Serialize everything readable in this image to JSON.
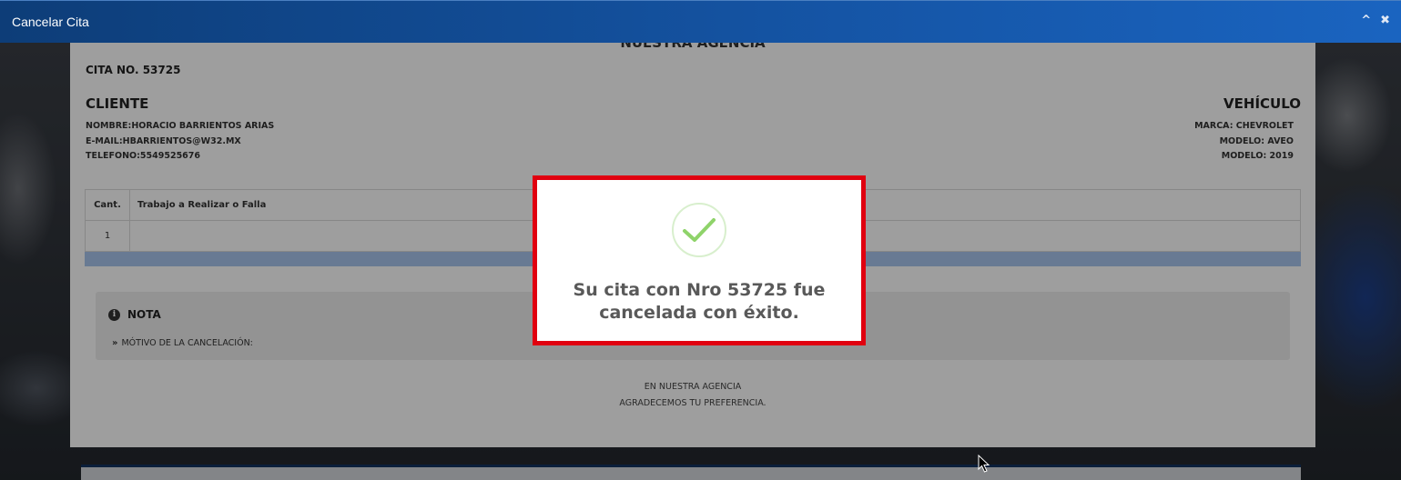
{
  "window": {
    "title": "Cancelar Cita",
    "controls": {
      "collapse": "^",
      "close": "✖"
    }
  },
  "appointment": {
    "heading": "NUESTRA AGENCIA",
    "cita_no": "CITA NO. 53725",
    "cliente": {
      "title": "CLIENTE",
      "nombre": "NOMBRE:HORACIO BARRIENTOS ARIAS",
      "email": "E-MAIL:HBARRIENTOS@W32.MX",
      "telefono": "TELEFONO:5549525676"
    },
    "vehiculo": {
      "title": "VEHÍCULO",
      "marca": "MARCA: CHEVROLET",
      "modelo": "MODELO: AVEO",
      "anio": "MODELO: 2019"
    },
    "table": {
      "headers": [
        "Cant.",
        "Trabajo a Realizar o Falla"
      ],
      "rows": [
        {
          "cant": "1",
          "trabajo": ""
        }
      ]
    },
    "nota": {
      "title": "NOTA",
      "motivo": "MÓTIVO DE LA CANCELACIÓN:"
    },
    "footer": {
      "line1": "EN NUESTRA AGENCIA",
      "line2": "AGRADECEMOS TU PREFERENCIA."
    }
  },
  "dialog": {
    "message": "Su cita con Nro 53725 fue cancelada con éxito."
  },
  "colors": {
    "titlebar": "#1555a6",
    "dialog_border": "#e0000f",
    "success_check": "#8fd36a",
    "table_bar": "#a9c6ee"
  },
  "icons": {
    "success": "checkmark-icon",
    "nota": "info-icon",
    "motivo": "double-chevron-right-icon"
  }
}
